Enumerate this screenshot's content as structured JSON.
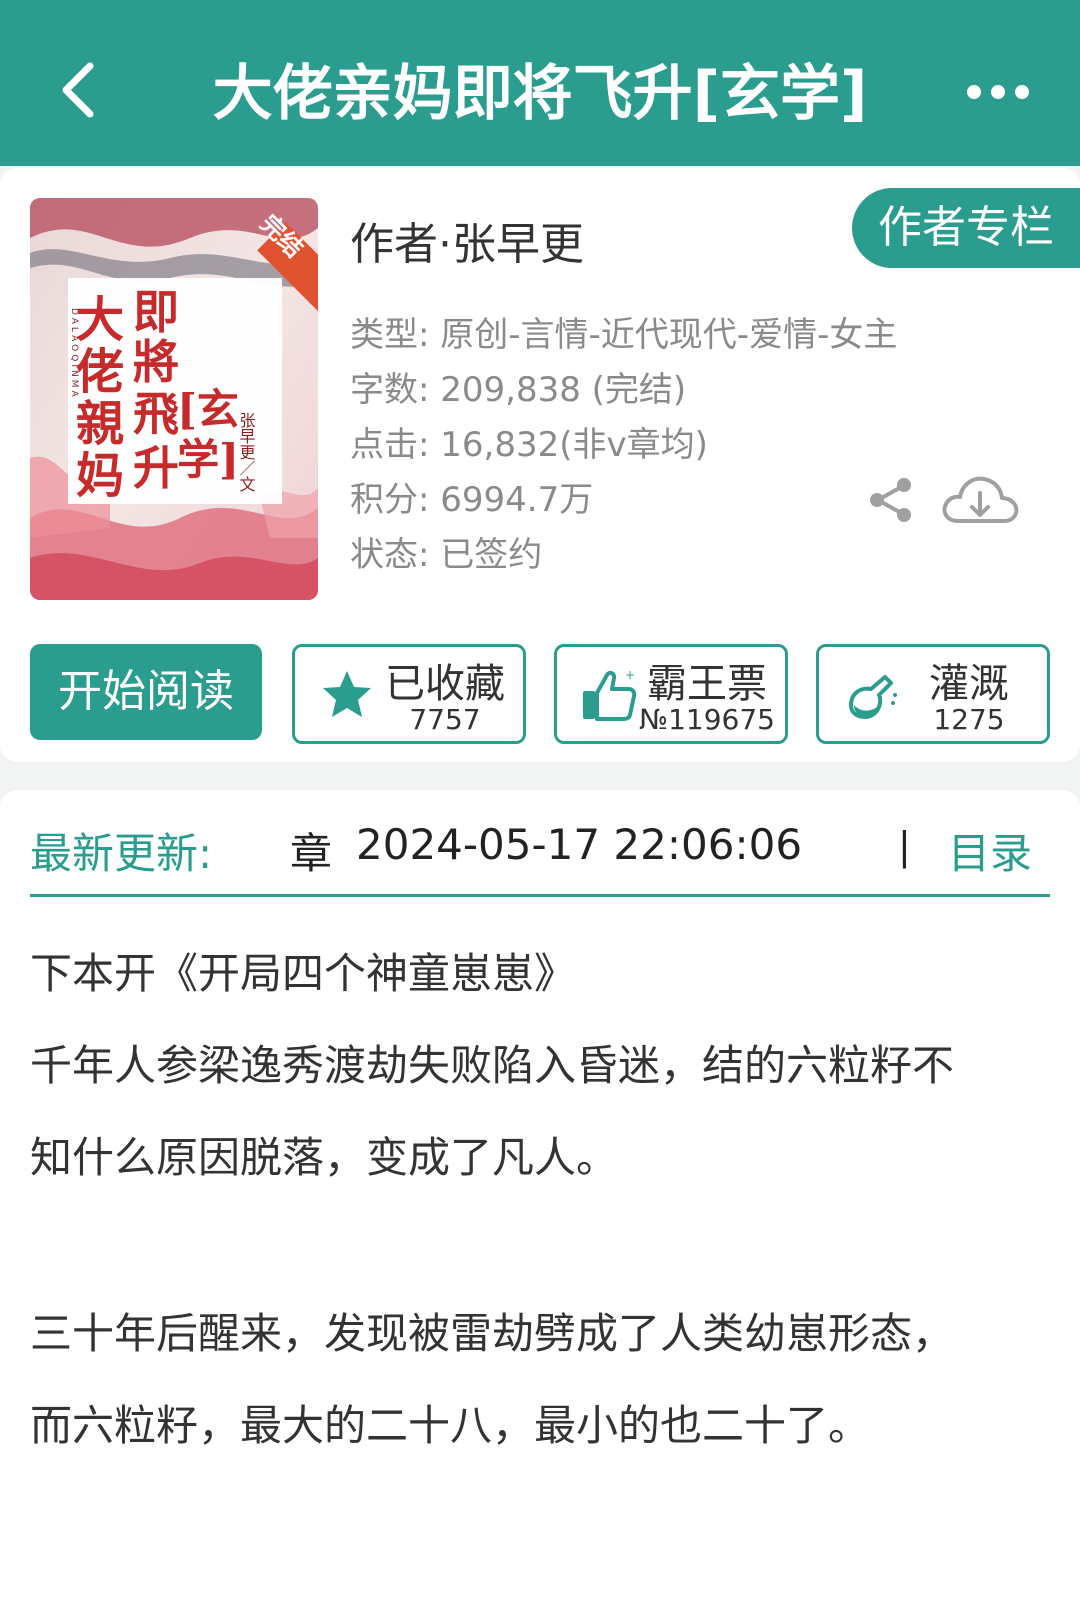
{
  "header": {
    "title": "大佬亲妈即将飞升[玄学]"
  },
  "book": {
    "cover": {
      "badge": "完结",
      "title_chars": [
        "大",
        "佬",
        "親",
        "妈",
        "即",
        "將",
        "飛",
        "升"
      ],
      "subtitle_chars": [
        "[玄",
        "学]"
      ],
      "author_vertical": "张早更／文",
      "pinyin": "DALAOQINMA"
    },
    "author": "作者·张早更",
    "author_column_label": "作者专栏",
    "meta": {
      "type": "类型: 原创-言情-近代现代-爱情-女主",
      "word_count": "字数: 209,838 (完结)",
      "clicks": "点击: 16,832(非v章均)",
      "score": "积分: 6994.7万",
      "status": "状态: 已签约"
    }
  },
  "actions": {
    "start_reading": "开始阅读",
    "favorite": {
      "label": "已收藏",
      "count": "7757"
    },
    "vote": {
      "label": "霸王票",
      "count": "№119675"
    },
    "water": {
      "label": "灌溉",
      "count": "1275"
    }
  },
  "update": {
    "label": "最新更新:",
    "chapter": "章",
    "time": "2024-05-17 22:06:06",
    "separator": "|",
    "toc": "目录"
  },
  "synopsis": {
    "lines": [
      "下本开《开局四个神童崽崽》",
      "千年人参梁逸秀渡劫失败陷入昏迷，结的六粒籽不",
      "知什么原因脱落，变成了凡人。",
      "三十年后醒来，发现被雷劫劈成了人类幼崽形态，",
      "而六粒籽，最大的二十八，最小的也二十了。"
    ]
  },
  "colors": {
    "primary": "#2a9d8f",
    "text": "#333333",
    "meta_text": "#8a8a8a"
  }
}
